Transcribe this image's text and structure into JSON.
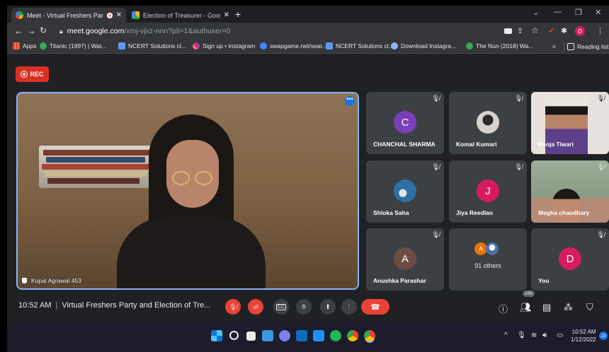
{
  "browser": {
    "tabs": [
      {
        "title": "Meet - Virtual Freshers Party",
        "active": true
      },
      {
        "title": "Election of Treasurer - Google D",
        "active": false
      }
    ],
    "url_host": "meet.google.com",
    "url_path": "/xmj-vjxz-nnn?pli=1&authuser=0",
    "bookmarks": [
      {
        "label": "Apps",
        "color": "#e8eaed"
      },
      {
        "label": "Titanic (1997) | Wat...",
        "color": "#34a853"
      },
      {
        "label": "NCERT Solutions cl...",
        "color": "#5e97f6"
      },
      {
        "label": "Sign up • Instagram",
        "color": "#e1306c"
      },
      {
        "label": "swapgame.net/sear...",
        "color": "#4285f4"
      },
      {
        "label": "NCERT Solutions cl...",
        "color": "#5e97f6"
      },
      {
        "label": "Download Instagra...",
        "color": "#8ab4f8"
      },
      {
        "label": "The Nun (2018) Wa...",
        "color": "#34a853"
      }
    ],
    "more": "»",
    "reading_list": "Reading list",
    "profile_initial": "D"
  },
  "meet": {
    "rec_label": "REC",
    "main_speaker": "Kopal Agrawal 453",
    "tiles": [
      {
        "name": "CHANCHAL SHARMA",
        "initial": "C",
        "color": "#7b3fb9",
        "type": "avatar"
      },
      {
        "name": "Komal Kumari",
        "initial": "",
        "color": "#d7d2cb",
        "type": "photo"
      },
      {
        "name": "Pooja Tiwari",
        "initial": "",
        "color": "#6a4f7a",
        "type": "camera"
      },
      {
        "name": "Shloka Saha",
        "initial": "",
        "color": "#2c6fa6",
        "type": "photo"
      },
      {
        "name": "Jiya Reedlan",
        "initial": "J",
        "color": "#d81b60",
        "type": "avatar"
      },
      {
        "name": "Megha chaudhary",
        "initial": "",
        "color": "#5a6b57",
        "type": "camera"
      },
      {
        "name": "Anushka Parashar",
        "initial": "A",
        "color": "#6d4c41",
        "type": "avatar"
      },
      {
        "name": "91 others",
        "initial": "A",
        "color": "#e8710a",
        "type": "others"
      },
      {
        "name": "You",
        "initial": "D",
        "color": "#d81b60",
        "type": "avatar"
      }
    ],
    "time": "10:52 AM",
    "meeting_title": "Virtual Freshers Party and Election of Tre...",
    "participants_badge": "100",
    "cc_label": "CC"
  },
  "taskbar": {
    "time": "10:52 AM",
    "date": "1/12/2022",
    "notifications": "23"
  }
}
